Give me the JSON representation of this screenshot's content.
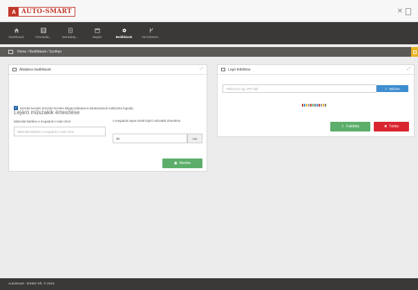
{
  "app": {
    "logo_text": "AUTO-SMART",
    "logo_mark": "A"
  },
  "nav": {
    "items": [
      {
        "label": "Dashboard",
        "icon": "home-icon"
      },
      {
        "label": "Törzsadat...",
        "icon": "database-icon"
      },
      {
        "label": "Munkalap...",
        "icon": "document-icon"
      },
      {
        "label": "Naptár",
        "icon": "calendar-icon"
      },
      {
        "label": "Beállítások",
        "icon": "gear-icon",
        "active": true
      },
      {
        "label": "Verziókövet...",
        "icon": "branch-icon"
      }
    ]
  },
  "breadcrumb": {
    "text": "Home / Beállítások / Szolhan"
  },
  "general_panel": {
    "title": "Általános beállítások",
    "checkbox_label": "Készlet kezelés (Készlet kezelés kikapcsolásával a darabszámok nullázódni fognak)",
    "checkbox_checked": true,
    "section_title": "Lejáró műszakik értesítése",
    "email_label": "Mászolat küldése a megadott e-mail címre",
    "email_placeholder": "Mászolat küldése a megadott e-mail címre",
    "days_label": "A megadott napon belül lejáró műszakik értesítése",
    "days_value": "30",
    "days_unit": "nap",
    "save_button": "Mentés"
  },
  "logo_panel": {
    "title": "Logó feltöltése",
    "file_placeholder": "Tallózza ki egy JPG fájlt",
    "browse_button": "Tallózás",
    "upload_button": "Feltöltés",
    "delete_button": "Törlés"
  },
  "footer": {
    "text": "AutoSmart - DSMC-Kft. © 2015"
  },
  "colors": {
    "nav_bg": "#3a3937",
    "breadcrumb_bg": "#5b5a57",
    "accent_yellow": "#e8b424",
    "btn_green": "#5cae6a",
    "btn_red": "#d9252f",
    "btn_blue": "#3e8ed0",
    "logo_red": "#c0392b"
  }
}
